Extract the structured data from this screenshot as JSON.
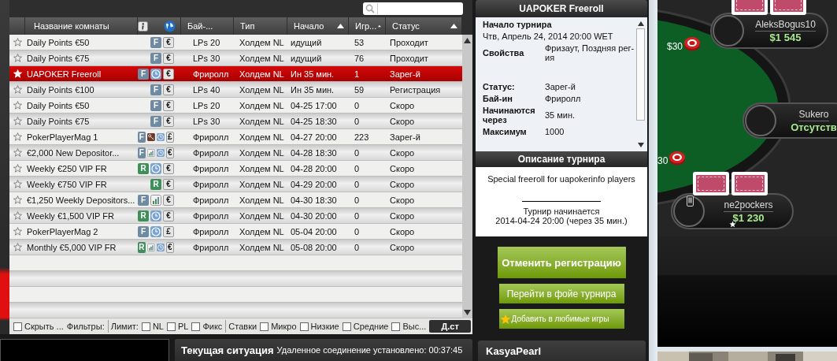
{
  "lobby": {
    "columns": [
      {
        "kind": "star"
      },
      {
        "kind": "text",
        "label": "Название комнаты",
        "sort_arrow": false
      },
      {
        "kind": "icons"
      },
      {
        "kind": "text",
        "label": "Бай-...",
        "sort_arrow": false
      },
      {
        "kind": "text",
        "label": "Тип",
        "sort_arrow": false
      },
      {
        "kind": "text",
        "label": "Начало",
        "sort_arrow": true
      },
      {
        "kind": "text",
        "label": "Игр...",
        "sort_arrow": true
      },
      {
        "kind": "text",
        "label": "Статус",
        "sort_arrow": true
      }
    ],
    "rows": [
      {
        "name": "Daily Points €50",
        "badges": [
          {
            "kind": "letter",
            "text": "F",
            "color": "#6f8aa3"
          },
          {
            "kind": "currency",
            "text": "€"
          }
        ],
        "buyin": "LPs 20",
        "type": "Холдем NL",
        "start": "идущий",
        "players": "53",
        "status": "Проходит",
        "selected": false
      },
      {
        "name": "Daily Points €75",
        "badges": [
          {
            "kind": "letter",
            "text": "F",
            "color": "#6f8aa3"
          },
          {
            "kind": "currency",
            "text": "€"
          }
        ],
        "buyin": "LPs 30",
        "type": "Холдем NL",
        "start": "идущий",
        "players": "76",
        "status": "Проходит",
        "selected": false
      },
      {
        "name": "UAPOKER Freeroll",
        "badges": [
          {
            "kind": "letter",
            "text": "F",
            "color": "#6f8aa3"
          },
          {
            "kind": "clock"
          },
          {
            "kind": "currency",
            "text": "€"
          }
        ],
        "buyin": "Фриролл",
        "type": "Холдем NL",
        "start": "Ин 35 мин.",
        "players": "1",
        "status": "Зарег-й",
        "selected": true
      },
      {
        "name": "Daily Points €100",
        "badges": [
          {
            "kind": "letter",
            "text": "F",
            "color": "#6f8aa3"
          },
          {
            "kind": "currency",
            "text": "€"
          }
        ],
        "buyin": "LPs 40",
        "type": "Холдем NL",
        "start": "Ин 35 мин.",
        "players": "59",
        "status": "Регистрация",
        "selected": false
      },
      {
        "name": "Daily Points €50",
        "badges": [
          {
            "kind": "letter",
            "text": "F",
            "color": "#6f8aa3"
          },
          {
            "kind": "currency",
            "text": "€"
          }
        ],
        "buyin": "LPs 20",
        "type": "Холдем NL",
        "start": "04-25 17:00",
        "players": "0",
        "status": "Скоро",
        "selected": false
      },
      {
        "name": "Daily Points €75",
        "badges": [
          {
            "kind": "letter",
            "text": "F",
            "color": "#6f8aa3"
          },
          {
            "kind": "currency",
            "text": "€"
          }
        ],
        "buyin": "LPs 30",
        "type": "Холдем NL",
        "start": "04-25 18:30",
        "players": "0",
        "status": "Скоро",
        "selected": false
      },
      {
        "name": "PokerPlayerMag 1",
        "badges": [
          {
            "kind": "letter",
            "text": "F",
            "color": "#6f8aa3"
          },
          {
            "kind": "key"
          },
          {
            "kind": "clock"
          },
          {
            "kind": "currency",
            "text": "£"
          }
        ],
        "buyin": "Фриролл",
        "type": "Холдем NL",
        "start": "04-27 20:00",
        "players": "223",
        "status": "Зарег-й",
        "selected": false
      },
      {
        "name": "€2,000 New Depositor...",
        "badges": [
          {
            "kind": "letter",
            "text": "F",
            "color": "#6f8aa3"
          },
          {
            "kind": "chart"
          },
          {
            "kind": "clock"
          },
          {
            "kind": "currency",
            "text": "€"
          }
        ],
        "buyin": "Фриролл",
        "type": "Холдем NL",
        "start": "04-28 18:30",
        "players": "0",
        "status": "Скоро",
        "selected": false
      },
      {
        "name": "Weekly €250 VIP FR",
        "badges": [
          {
            "kind": "letter",
            "text": "R",
            "color": "#3f8f5a"
          },
          {
            "kind": "clock"
          },
          {
            "kind": "currency",
            "text": "€"
          }
        ],
        "buyin": "Фриролл",
        "type": "Холдем NL",
        "start": "04-28 20:00",
        "players": "0",
        "status": "Скоро",
        "selected": false
      },
      {
        "name": "Weekly €750 VIP FR",
        "badges": [
          {
            "kind": "letter",
            "text": "R",
            "color": "#3f8f5a"
          },
          {
            "kind": "currency",
            "text": "€"
          }
        ],
        "buyin": "Фриролл",
        "type": "Холдем NL",
        "start": "04-29 20:00",
        "players": "0",
        "status": "Скоро",
        "selected": false
      },
      {
        "name": "€1,250 Weekly Depositors...",
        "badges": [
          {
            "kind": "letter",
            "text": "F",
            "color": "#6f8aa3"
          },
          {
            "kind": "chart"
          },
          {
            "kind": "currency",
            "text": "€"
          }
        ],
        "buyin": "Фриролл",
        "type": "Холдем NL",
        "start": "04-30 18:30",
        "players": "0",
        "status": "Скоро",
        "selected": false
      },
      {
        "name": "Weekly €1,500 VIP FR",
        "badges": [
          {
            "kind": "letter",
            "text": "R",
            "color": "#3f8f5a"
          },
          {
            "kind": "clock"
          },
          {
            "kind": "currency",
            "text": "€"
          }
        ],
        "buyin": "Фриролл",
        "type": "Холдем NL",
        "start": "04-30 20:00",
        "players": "0",
        "status": "Скоро",
        "selected": false
      },
      {
        "name": "PokerPlayerMag 2",
        "badges": [
          {
            "kind": "letter",
            "text": "F",
            "color": "#6f8aa3"
          },
          {
            "kind": "clock"
          },
          {
            "kind": "currency",
            "text": "£"
          }
        ],
        "buyin": "Фриролл",
        "type": "Холдем NL",
        "start": "05-04 20:00",
        "players": "0",
        "status": "Скоро",
        "selected": false
      },
      {
        "name": "Monthly €5,000 VIP FR",
        "badges": [
          {
            "kind": "letter",
            "text": "R",
            "color": "#3f8f5a"
          },
          {
            "kind": "chart"
          },
          {
            "kind": "clock"
          },
          {
            "kind": "currency",
            "text": "€"
          }
        ],
        "buyin": "Фриролл",
        "type": "Холдем NL",
        "start": "05-08 20:00",
        "players": "0",
        "status": "Скоро",
        "selected": false
      }
    ],
    "filters": [
      {
        "kind": "check",
        "label": "Скрыть ...",
        "checked": false
      },
      {
        "kind": "label",
        "text": "Фильтры:",
        "divider_before": false
      },
      {
        "kind": "label",
        "text": "Лимит:",
        "divider_before": true
      },
      {
        "kind": "check",
        "label": "NL",
        "checked": false
      },
      {
        "kind": "check",
        "label": "PL",
        "checked": false
      },
      {
        "kind": "check",
        "label": "Фикс",
        "checked": false
      },
      {
        "kind": "label",
        "text": "Ставки",
        "divider_before": true
      },
      {
        "kind": "check",
        "label": "Микро",
        "checked": false
      },
      {
        "kind": "check",
        "label": "Низкие",
        "checked": false
      },
      {
        "kind": "check",
        "label": "Средние",
        "checked": false
      },
      {
        "kind": "check",
        "label": "Выс...",
        "checked": false
      }
    ],
    "filter_button": "Д.ст"
  },
  "status_bar": {
    "title": "Текущая ситуация",
    "text": "Удаленное соединение установлено: 00:37:45"
  },
  "details": {
    "title": "UAPOKER Freeroll",
    "items": [
      {
        "kind": "heading",
        "text": "Начало турнира"
      },
      {
        "kind": "line",
        "text": "Чтв, Апрель 24, 2014 20:00 WET"
      },
      {
        "kind": "pair",
        "label": "Свойства",
        "value": "Фризаут, Поздняя рег-ия"
      },
      {
        "kind": "gap"
      },
      {
        "kind": "pair",
        "label": "Статус:",
        "value": "Зарег-й"
      },
      {
        "kind": "pair",
        "label": "Бай-ин",
        "value": "Фриролл"
      },
      {
        "kind": "pair",
        "label": "Начинаются через",
        "value": "35 мин."
      },
      {
        "kind": "pair",
        "label": "Максимум",
        "value": "1000"
      }
    ],
    "description_title": "Описание турнира",
    "description": "Special freeroll for uapokerinfo players",
    "starts_label": "Турнир начинается",
    "starts_at": "2014-04-24 20:00 (через 35 мин.)",
    "buttons": [
      {
        "kind": "primary",
        "label": "Отменить регистрацию"
      },
      {
        "kind": "secondary",
        "label": "Перейти в фойе турнира"
      },
      {
        "kind": "favorite",
        "label": "Добавить в любимые игры"
      }
    ]
  },
  "chat": {
    "user": "KasyaPearl"
  },
  "table": {
    "players": [
      {
        "name": "AleksBogus10",
        "stack": "$1 545",
        "cards": true,
        "dealer": false,
        "mobile": false
      },
      {
        "name": "Sukero",
        "stack": "Отсутств",
        "cards": false,
        "dealer": false,
        "mobile": false
      },
      {
        "name": "ne2pockers",
        "stack": "$1 230",
        "cards": true,
        "dealer": true,
        "mobile": true
      }
    ],
    "bets": [
      "$30",
      "30"
    ]
  }
}
